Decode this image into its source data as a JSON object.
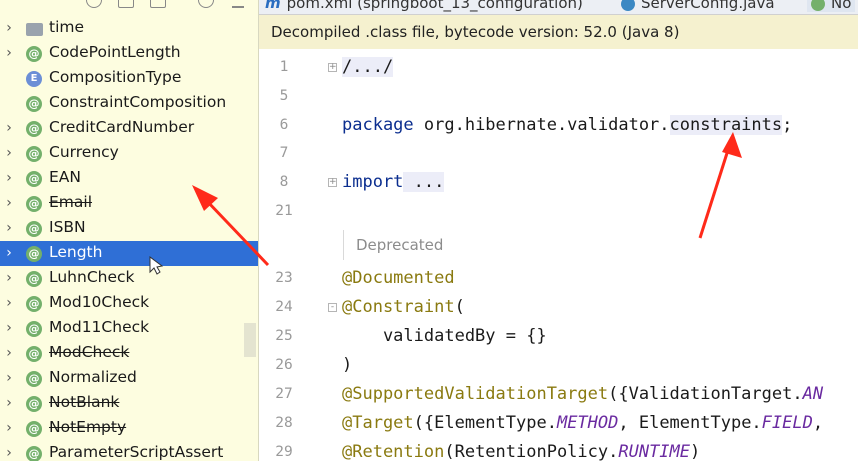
{
  "tree": {
    "items": [
      {
        "label": "time",
        "icon": "folder-icon",
        "expandable": true,
        "deprecated": false
      },
      {
        "label": "CodePointLength",
        "icon": "annotation-icon",
        "expandable": true,
        "deprecated": false
      },
      {
        "label": "CompositionType",
        "icon": "enum-icon",
        "expandable": false,
        "deprecated": false
      },
      {
        "label": "ConstraintComposition",
        "icon": "annotation-icon",
        "expandable": false,
        "deprecated": false
      },
      {
        "label": "CreditCardNumber",
        "icon": "annotation-icon",
        "expandable": true,
        "deprecated": false
      },
      {
        "label": "Currency",
        "icon": "annotation-icon",
        "expandable": true,
        "deprecated": false
      },
      {
        "label": "EAN",
        "icon": "annotation-icon",
        "expandable": true,
        "deprecated": false
      },
      {
        "label": "Email",
        "icon": "annotation-icon",
        "expandable": true,
        "deprecated": true
      },
      {
        "label": "ISBN",
        "icon": "annotation-icon",
        "expandable": true,
        "deprecated": false
      },
      {
        "label": "Length",
        "icon": "annotation-icon",
        "expandable": true,
        "deprecated": false,
        "selected": true
      },
      {
        "label": "LuhnCheck",
        "icon": "annotation-icon",
        "expandable": true,
        "deprecated": false
      },
      {
        "label": "Mod10Check",
        "icon": "annotation-icon",
        "expandable": true,
        "deprecated": false
      },
      {
        "label": "Mod11Check",
        "icon": "annotation-icon",
        "expandable": true,
        "deprecated": false
      },
      {
        "label": "ModCheck",
        "icon": "annotation-icon",
        "expandable": true,
        "deprecated": true
      },
      {
        "label": "Normalized",
        "icon": "annotation-icon",
        "expandable": true,
        "deprecated": false
      },
      {
        "label": "NotBlank",
        "icon": "annotation-icon",
        "expandable": true,
        "deprecated": true
      },
      {
        "label": "NotEmpty",
        "icon": "annotation-icon",
        "expandable": true,
        "deprecated": true
      },
      {
        "label": "ParameterScriptAssert",
        "icon": "annotation-icon",
        "expandable": true,
        "deprecated": false
      }
    ]
  },
  "tabs": {
    "tab1": "pom.xml (springboot_13_configuration)",
    "tab2": "ServerConfig.java",
    "tab3": "No"
  },
  "editor": {
    "banner": "Decompiled .class file, bytecode version: 52.0 (Java 8)",
    "line_numbers": [
      "1",
      "5",
      "6",
      "7",
      "8",
      "21",
      "23",
      "24",
      "25",
      "26",
      "27",
      "28",
      "29"
    ],
    "deprecated_hint": "Deprecated",
    "lines": {
      "l1": "/.../",
      "l6_kw": "package",
      "l6_rest": " org.hibernate.validator.",
      "l6_hl": "constraints",
      "l6_end": ";",
      "l8_kw": "import",
      "l8_rest": " ...",
      "l23": "@Documented",
      "l24_ann": "@Constraint",
      "l24_rest": "(",
      "l25": "    validatedBy = {}",
      "l26": ")",
      "l27_ann": "@SupportedValidationTarget",
      "l27_rest": "({ValidationTarget.",
      "l27_it": "AN",
      "l28_ann": "@Target",
      "l28_rest1": "({ElementType.",
      "l28_it1": "METHOD",
      "l28_rest2": ", ElementType.",
      "l28_it2": "FIELD",
      "l28_rest3": ",",
      "l29_ann": "@Retention",
      "l29_rest": "(RetentionPolicy.",
      "l29_it": "RUNTIME",
      "l29_end": ")"
    }
  },
  "colors": {
    "selection": "#2f6fd6",
    "tree_bg": "#fdfde0",
    "banner_bg": "#f5f1cf",
    "arrow": "#ff2a1a"
  }
}
